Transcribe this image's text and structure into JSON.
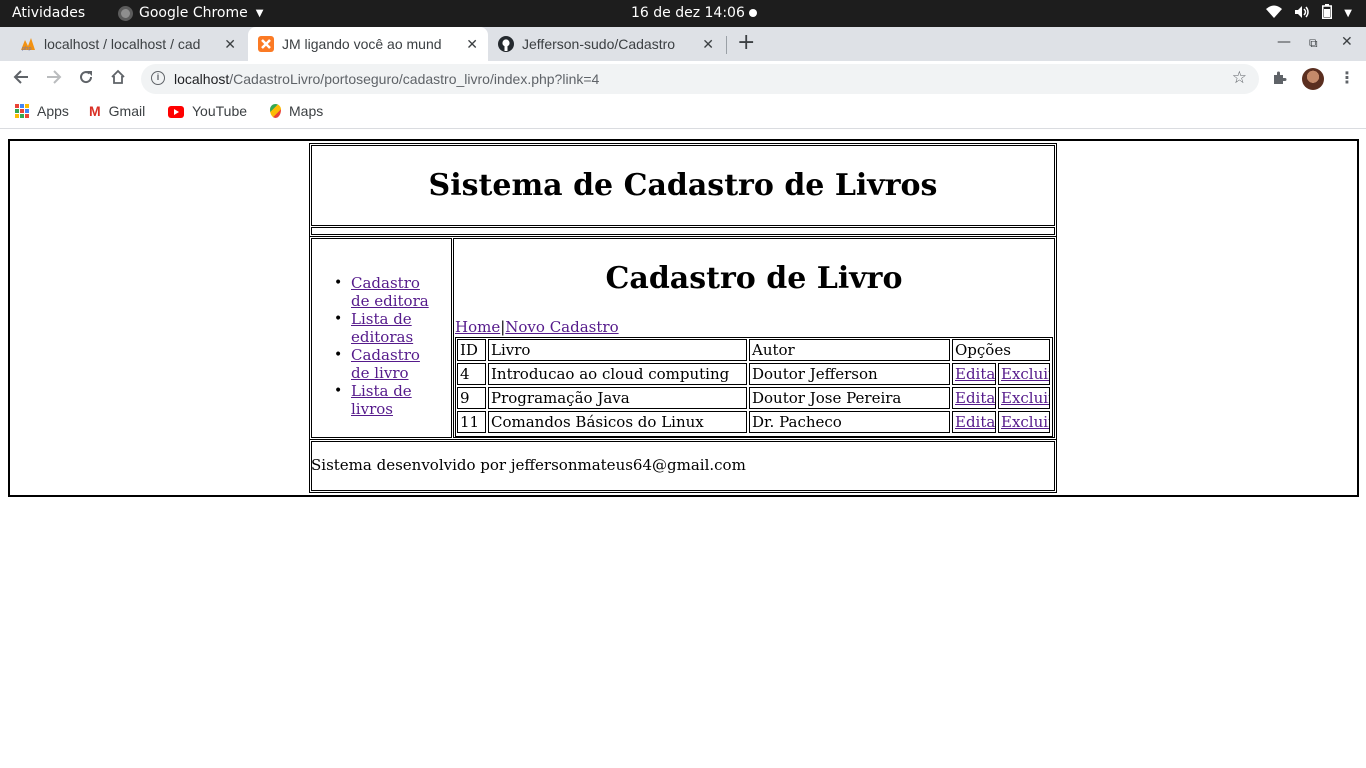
{
  "system_bar": {
    "activities": "Atividades",
    "app_name": "Google Chrome",
    "datetime": "16 de dez  14:06"
  },
  "tabs": [
    {
      "title": "localhost / localhost / cad",
      "icon": "phpmyadmin-icon",
      "active": false
    },
    {
      "title": "JM ligando você ao mund",
      "icon": "xampp-icon",
      "active": true
    },
    {
      "title": "Jefferson-sudo/Cadastro",
      "icon": "github-icon",
      "active": false
    }
  ],
  "address_bar": {
    "host": "localhost",
    "path": "/CadastroLivro/portoseguro/cadastro_livro/index.php?link=4"
  },
  "bookmarks": [
    {
      "label": "Apps",
      "icon": "apps-grid-icon"
    },
    {
      "label": "Gmail",
      "icon": "gmail-icon"
    },
    {
      "label": "YouTube",
      "icon": "youtube-icon"
    },
    {
      "label": "Maps",
      "icon": "maps-icon"
    }
  ],
  "page": {
    "header_title": "Sistema de Cadastro de Livros",
    "sidebar_links": [
      "Cadastro de editora",
      "Lista de editoras",
      "Cadastro de livro",
      "Lista de livros"
    ],
    "main_title": "Cadastro de Livro",
    "nav": {
      "home": "Home",
      "separator": "|",
      "new": "Novo Cadastro"
    },
    "table": {
      "headers": [
        "ID",
        "Livro",
        "Autor",
        "Opções"
      ],
      "rows": [
        {
          "id": "4",
          "livro": "Introducao ao cloud computing",
          "autor": "Doutor Jefferson",
          "edit": "Editar",
          "delete": "Excluir"
        },
        {
          "id": "9",
          "livro": "Programação Java",
          "autor": "Doutor Jose Pereira",
          "edit": "Editar",
          "delete": "Excluir"
        },
        {
          "id": "11",
          "livro": "Comandos Básicos do Linux",
          "autor": "Dr. Pacheco",
          "edit": "Editar",
          "delete": "Excluir"
        }
      ]
    },
    "footer": "Sistema desenvolvido por jeffersonmateus64@gmail.com"
  }
}
